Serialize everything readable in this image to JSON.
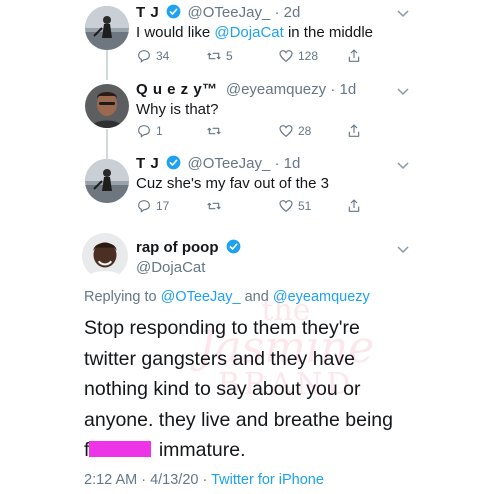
{
  "thread": [
    {
      "name": "T J",
      "handle": "@OTeeJay_",
      "time": "· 2d",
      "text_parts": [
        "I would like ",
        "@DojaCat",
        " in the middle"
      ],
      "replies": "34",
      "retweets": "5",
      "likes": "128",
      "verified": true
    },
    {
      "name": "Q u e z y™",
      "handle": "@eyeamquezy",
      "time": "· 1d",
      "text_parts": [
        "Why is that?"
      ],
      "replies": "1",
      "retweets": "",
      "likes": "28",
      "verified": false
    },
    {
      "name": "T J",
      "handle": "@OTeeJay_",
      "time": "· 1d",
      "text_parts": [
        "Cuz she's my fav out of the 3"
      ],
      "replies": "17",
      "retweets": "",
      "likes": "51",
      "verified": true
    }
  ],
  "main_tweet": {
    "name": "rap of poop",
    "handle": "@DojaCat",
    "replying_prefix": "Replying to ",
    "replying_user1": "@OTeeJay_",
    "replying_and": " and ",
    "replying_user2": "@eyeamquezy",
    "lines": [
      "Stop responding to them they're",
      "twitter gangsters and they have",
      "nothing kind to say about you or",
      "anyone. they live and breathe being"
    ],
    "last_line_start": "f",
    "last_line_end": " immature.",
    "time": "2:12 AM · 4/13/20 · ",
    "source": "Twitter for iPhone"
  },
  "watermark": {
    "line1": "the",
    "line2": "Jasmine",
    "line3": "BRAND"
  },
  "colors": {
    "accent": "#1da1f2",
    "muted": "#657786",
    "redaction": "#ee34e7"
  },
  "icons": [
    "verified-badge-icon",
    "reply-icon",
    "retweet-icon",
    "like-icon",
    "share-icon",
    "chevron-down-icon"
  ]
}
